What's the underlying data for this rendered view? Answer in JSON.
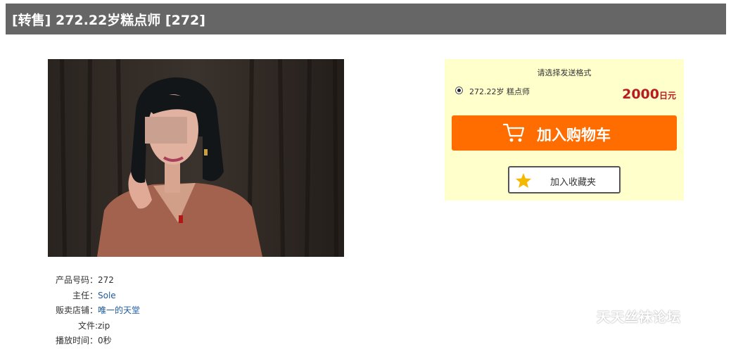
{
  "header": {
    "title": "[转售] 272.22岁糕点师 [272]"
  },
  "product_image": {
    "icon": "product-photo"
  },
  "info": {
    "code_label": "产品号码：",
    "code_value": "272",
    "lead_label": "主任：",
    "lead_value": "Sole",
    "shop_label": "贩卖店铺：",
    "shop_value": "唯一的天堂",
    "file_label": "文件:",
    "file_value": "zip",
    "duration_label": "播放时间：",
    "duration_value": "0秒"
  },
  "purchase": {
    "heading": "请选择发送格式",
    "format_label": "272.22岁 糕点师",
    "price_amount": "2000",
    "price_unit": "日元",
    "cart_label": "加入购物车",
    "favorite_label": "加入收藏夹"
  },
  "colors": {
    "header_bg": "#666666",
    "panel_bg": "#ffffcc",
    "cart_bg": "#ff6c00",
    "price": "#b81c22",
    "link": "#1e5a9e",
    "star": "#f5b800"
  },
  "watermark": {
    "text": "天天丝袜论坛"
  }
}
